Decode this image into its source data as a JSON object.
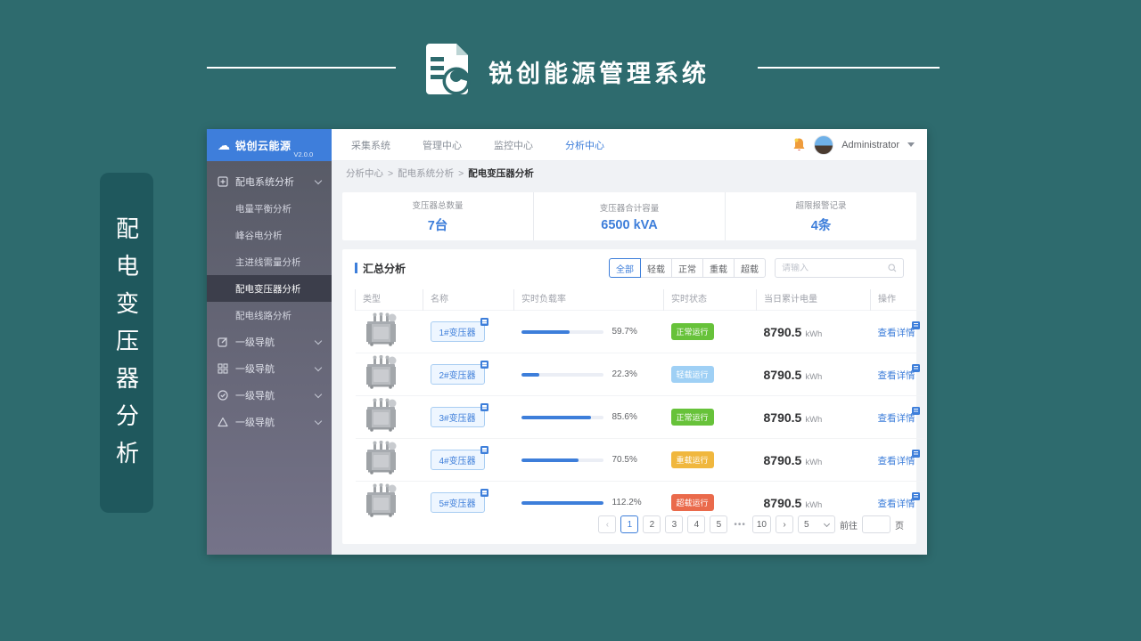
{
  "slide": {
    "title": "锐创能源管理系统",
    "side_tag": "配电变压器分析"
  },
  "colors": {
    "accent_blue": "#3d7eda",
    "teal_bg": "#2e6b6e",
    "green": "#67c23a",
    "light_blue": "#9fd0f5",
    "yellow": "#f0b73e",
    "red": "#ea6a4b"
  },
  "sidebar": {
    "logo_text": "锐创云能源",
    "logo_version": "V2.0.0",
    "group_label": "配电系统分析",
    "children": [
      "电量平衡分析",
      "峰谷电分析",
      "主进线需量分析",
      "配电变压器分析",
      "配电线路分析"
    ],
    "active_child": "配电变压器分析",
    "nav_items": [
      "一级导航",
      "一级导航",
      "一级导航",
      "一级导航"
    ]
  },
  "topnav": {
    "items": [
      "采集系统",
      "管理中心",
      "监控中心",
      "分析中心"
    ],
    "active": "分析中心",
    "user": "Administrator"
  },
  "breadcrumb": {
    "items": [
      "分析中心",
      "配电系统分析",
      "配电变压器分析"
    ],
    "separator": ">"
  },
  "stats": [
    {
      "label": "变压器总数量",
      "value": "7台"
    },
    {
      "label": "变压器合计容量",
      "value": "6500 kVA"
    },
    {
      "label": "超限报警记录",
      "value": "4条"
    }
  ],
  "summary": {
    "title": "汇总分析",
    "filters": [
      "全部",
      "轻载",
      "正常",
      "重载",
      "超载"
    ],
    "active_filter": "全部",
    "search_placeholder": "请输入",
    "headers": [
      "类型",
      "名称",
      "实时负载率",
      "实时状态",
      "当日累计电量",
      "操作"
    ],
    "rows": [
      {
        "name": "1#变压器",
        "load_pct": "59.7%",
        "load_value": 59.7,
        "status": "正常运行",
        "status_type": "normal",
        "energy": "8790.5",
        "unit": "kWh",
        "action": "查看详情"
      },
      {
        "name": "2#变压器",
        "load_pct": "22.3%",
        "load_value": 22.3,
        "status": "轻载运行",
        "status_type": "light",
        "energy": "8790.5",
        "unit": "kWh",
        "action": "查看详情"
      },
      {
        "name": "3#变压器",
        "load_pct": "85.6%",
        "load_value": 85.6,
        "status": "正常运行",
        "status_type": "normal",
        "energy": "8790.5",
        "unit": "kWh",
        "action": "查看详情"
      },
      {
        "name": "4#变压器",
        "load_pct": "70.5%",
        "load_value": 70.5,
        "status": "重载运行",
        "status_type": "heavy",
        "energy": "8790.5",
        "unit": "kWh",
        "action": "查看详情"
      },
      {
        "name": "5#变压器",
        "load_pct": "112.2%",
        "load_value": 112.2,
        "status": "超载运行",
        "status_type": "overload",
        "energy": "8790.5",
        "unit": "kWh",
        "action": "查看详情"
      }
    ]
  },
  "pagination": {
    "prev": "‹",
    "next": "›",
    "pages": [
      "1",
      "2",
      "3",
      "4",
      "5"
    ],
    "ellipsis": "•••",
    "last_page": "10",
    "active_page": "1",
    "page_size": "5",
    "goto_label": "前往",
    "page_unit": "页"
  }
}
